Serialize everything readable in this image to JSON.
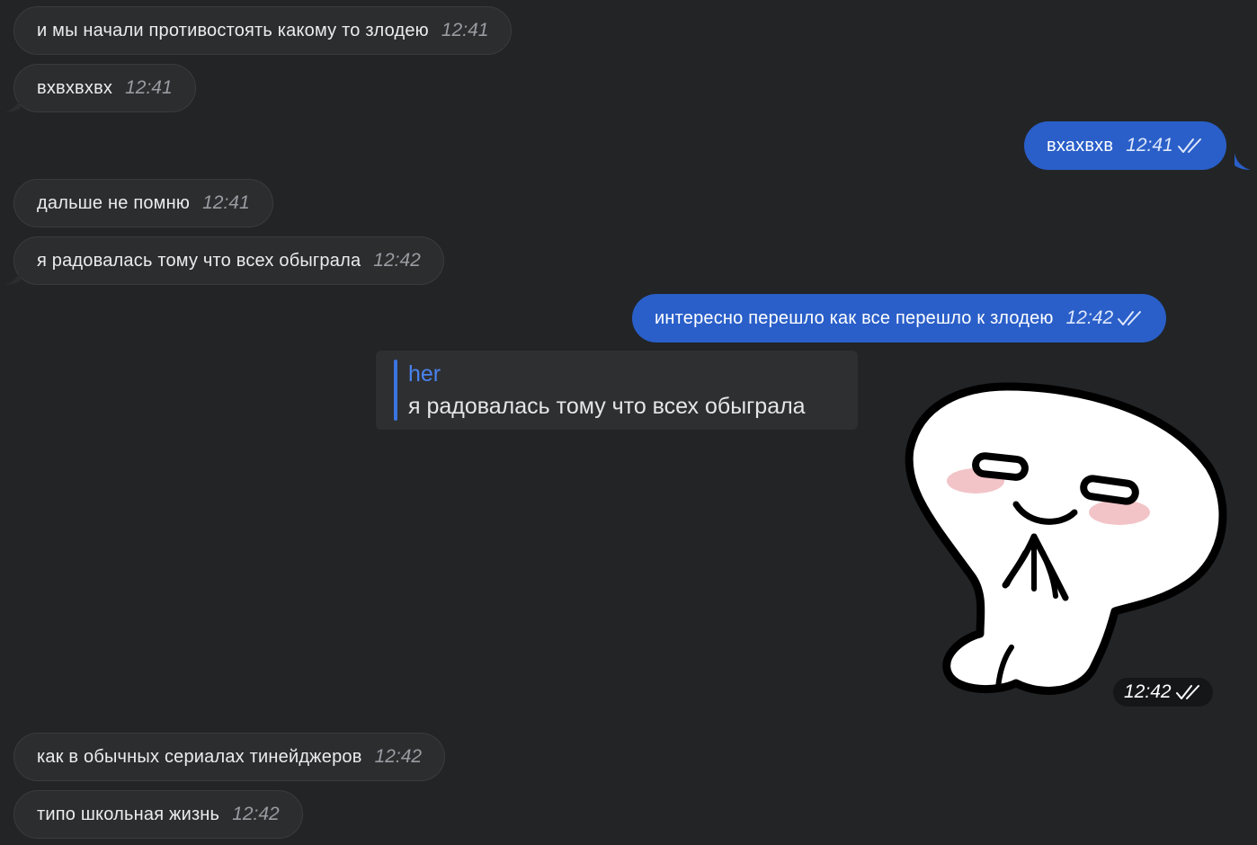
{
  "messages": [
    {
      "text": "и мы начали противостоять какому то злодею",
      "time": "12:41"
    },
    {
      "text": "вхвхвхвх",
      "time": "12:41"
    },
    {
      "text": "вхахвхв",
      "time": "12:41"
    },
    {
      "text": "дальше не помню",
      "time": "12:41"
    },
    {
      "text": "я радовалась тому что всех обыграла",
      "time": "12:42"
    },
    {
      "text": "интересно перешло как все перешло к злодею",
      "time": "12:42"
    },
    {
      "text": "как в обычных сериалах тинейджеров",
      "time": "12:42"
    },
    {
      "text": "типо школьная жизнь",
      "time": "12:42"
    }
  ],
  "reply": {
    "author": "her",
    "text": "я радовалась тому что всех обыграла"
  },
  "sticker": {
    "icon": "blushing-ghost-sticker",
    "time": "12:42"
  },
  "colors": {
    "background": "#222426",
    "incoming_bubble": "#2c2d2f",
    "outgoing_bubble": "#2a5fc9",
    "reply_accent": "#3b74e0"
  }
}
